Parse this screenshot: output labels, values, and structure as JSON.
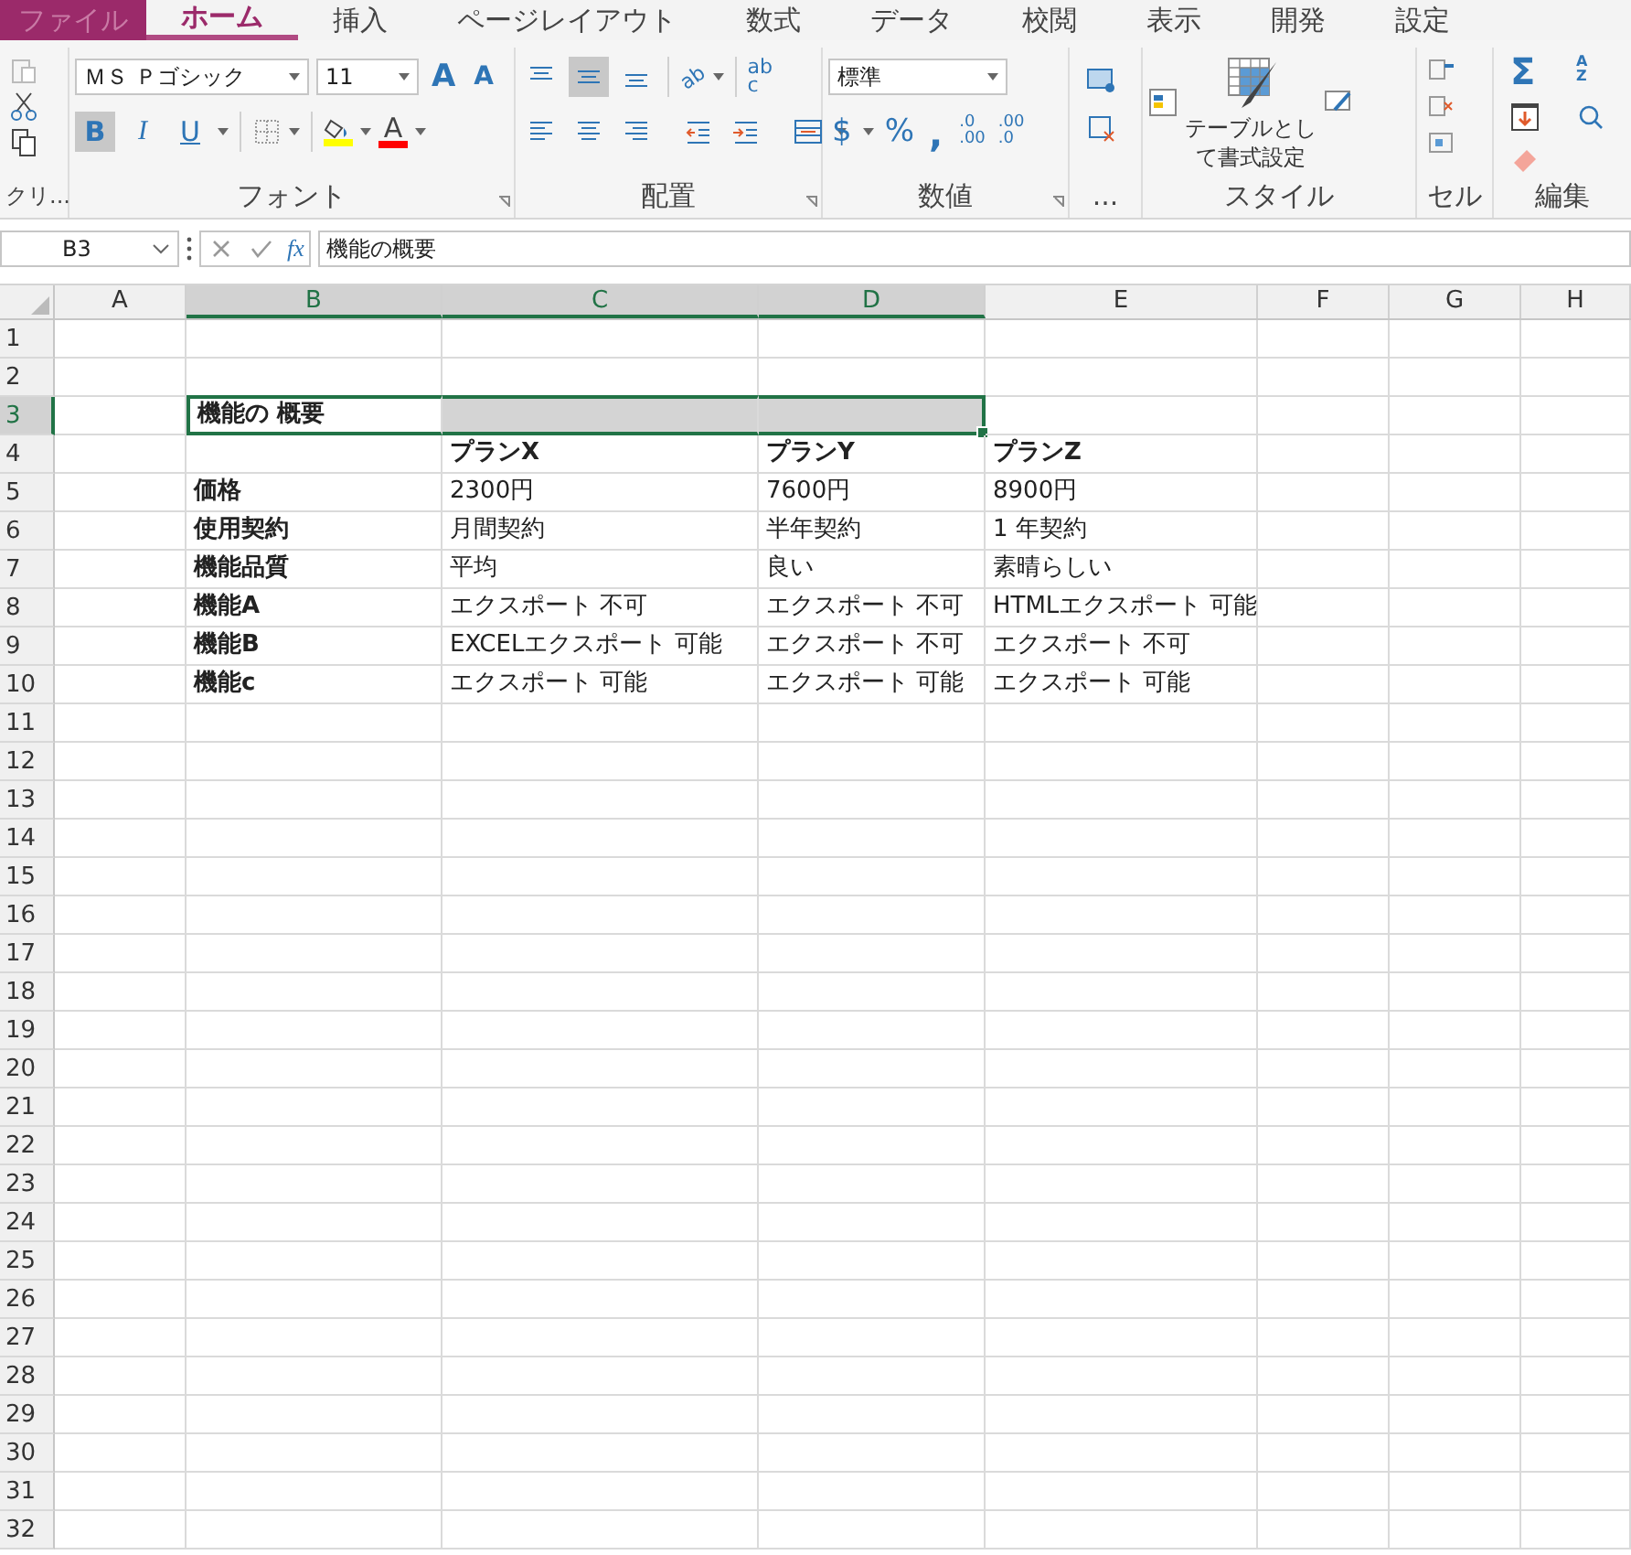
{
  "tabs": [
    {
      "label": "ファイル",
      "kind": "file",
      "selected": false
    },
    {
      "label": "ホーム",
      "kind": "tab",
      "selected": true
    },
    {
      "label": "挿入",
      "kind": "tab",
      "selected": false
    },
    {
      "label": "ページレイアウト",
      "kind": "tab",
      "selected": false
    },
    {
      "label": "数式",
      "kind": "tab",
      "selected": false
    },
    {
      "label": "データ",
      "kind": "tab",
      "selected": false
    },
    {
      "label": "校閲",
      "kind": "tab",
      "selected": false
    },
    {
      "label": "表示",
      "kind": "tab",
      "selected": false
    },
    {
      "label": "開発",
      "kind": "tab",
      "selected": false
    },
    {
      "label": "設定",
      "kind": "tab",
      "selected": false
    }
  ],
  "ribbon": {
    "clipboard": {
      "label": "クリ..."
    },
    "font": {
      "label": "フォント",
      "font_name": "ＭＳ Ｐゴシック",
      "font_size": "11",
      "grow": "A",
      "shrink": "A",
      "styles": [
        {
          "label": "B",
          "kind": "bold",
          "selected": true
        },
        {
          "label": "I",
          "kind": "italic",
          "selected": false
        },
        {
          "label": "U",
          "kind": "underline",
          "selected": false
        }
      ],
      "fill": {
        "color": "#ffff00"
      },
      "font_color": {
        "label": "A",
        "color": "#ff0000"
      }
    },
    "alignment": {
      "label": "配置",
      "vertical": [
        {
          "selected": false
        },
        {
          "selected": true
        },
        {
          "selected": false
        }
      ],
      "orientation_text": "ab",
      "wrap_text": [
        "ab",
        "c"
      ]
    },
    "number": {
      "label": "数値",
      "format": "標準",
      "currency": "$",
      "percent": "%",
      "comma": ",",
      "increase_decimal": [
        ".0",
        ".00"
      ],
      "decrease_decimal": [
        ".00",
        ".0"
      ]
    },
    "more": {
      "label": "..."
    },
    "styles": {
      "label": "スタイル",
      "table_format": [
        "テーブルとし",
        "て書式設定"
      ]
    },
    "cells": {
      "label": "セル"
    },
    "editing": {
      "label": "編集",
      "sum": "Σ",
      "sort_text": [
        "A",
        "Z"
      ]
    }
  },
  "formula_bar": {
    "name_box": "B3",
    "fx": "fx",
    "formula": "機能の概要"
  },
  "columns": [
    {
      "label": "A",
      "selected": false
    },
    {
      "label": "B",
      "selected": true
    },
    {
      "label": "C",
      "selected": true
    },
    {
      "label": "D",
      "selected": true
    },
    {
      "label": "E",
      "selected": false
    },
    {
      "label": "F",
      "selected": false
    },
    {
      "label": "G",
      "selected": false
    },
    {
      "label": "H",
      "selected": false
    }
  ],
  "rows": [
    {
      "number": "1",
      "selected": false
    },
    {
      "number": "2",
      "selected": false
    },
    {
      "number": "3",
      "selected": true,
      "cells": [
        null,
        {
          "text": "機能の 概要",
          "bold": true,
          "selected": true,
          "active": true
        },
        {
          "selected": true,
          "active": false
        },
        {
          "selected": true,
          "active": false
        }
      ]
    },
    {
      "number": "4",
      "selected": false,
      "cells": [
        null,
        null,
        {
          "text": "プランX",
          "bold": true
        },
        {
          "text": "プランY",
          "bold": true
        },
        {
          "text": "プランZ",
          "bold": true
        }
      ]
    },
    {
      "number": "5",
      "selected": false,
      "cells": [
        null,
        {
          "text": "価格",
          "bold": true
        },
        {
          "text": "2300円",
          "bold": false
        },
        {
          "text": "7600円",
          "bold": false
        },
        {
          "text": "8900円",
          "bold": false
        }
      ]
    },
    {
      "number": "6",
      "selected": false,
      "cells": [
        null,
        {
          "text": "使用契約",
          "bold": true
        },
        {
          "text": "月間契約",
          "bold": false
        },
        {
          "text": "半年契約",
          "bold": false
        },
        {
          "text": "1 年契約",
          "bold": false
        }
      ]
    },
    {
      "number": "7",
      "selected": false,
      "cells": [
        null,
        {
          "text": "機能品質",
          "bold": true
        },
        {
          "text": "平均",
          "bold": false
        },
        {
          "text": "良い",
          "bold": false
        },
        {
          "text": "素晴らしい",
          "bold": false
        }
      ]
    },
    {
      "number": "8",
      "selected": false,
      "cells": [
        null,
        {
          "text": "機能A",
          "bold": true
        },
        {
          "text": "エクスポート 不可",
          "bold": false
        },
        {
          "text": "エクスポート 不可",
          "bold": false
        },
        {
          "text": "HTMLエクスポート 可能",
          "bold": false
        }
      ]
    },
    {
      "number": "9",
      "selected": false,
      "cells": [
        null,
        {
          "text": "機能B",
          "bold": true
        },
        {
          "text": "EXCELエクスポート 可能",
          "bold": false
        },
        {
          "text": "エクスポート 不可",
          "bold": false
        },
        {
          "text": "エクスポート 不可",
          "bold": false
        }
      ]
    },
    {
      "number": "10",
      "selected": false,
      "cells": [
        null,
        {
          "text": "機能c",
          "bold": true
        },
        {
          "text": "エクスポート 可能",
          "bold": false
        },
        {
          "text": "エクスポート 可能",
          "bold": false
        },
        {
          "text": "エクスポート 可能",
          "bold": false
        }
      ]
    },
    {
      "number": "11",
      "selected": false
    },
    {
      "number": "12",
      "selected": false
    },
    {
      "number": "13",
      "selected": false
    },
    {
      "number": "14",
      "selected": false
    },
    {
      "number": "15",
      "selected": false
    },
    {
      "number": "16",
      "selected": false
    },
    {
      "number": "17",
      "selected": false
    },
    {
      "number": "18",
      "selected": false
    },
    {
      "number": "19",
      "selected": false
    },
    {
      "number": "20",
      "selected": false
    },
    {
      "number": "21",
      "selected": false
    },
    {
      "number": "22",
      "selected": false
    },
    {
      "number": "23",
      "selected": false
    },
    {
      "number": "24",
      "selected": false
    },
    {
      "number": "25",
      "selected": false
    },
    {
      "number": "26",
      "selected": false
    },
    {
      "number": "27",
      "selected": false
    },
    {
      "number": "28",
      "selected": false
    },
    {
      "number": "29",
      "selected": false
    },
    {
      "number": "30",
      "selected": false
    },
    {
      "number": "31",
      "selected": false
    },
    {
      "number": "32",
      "selected": false
    }
  ]
}
